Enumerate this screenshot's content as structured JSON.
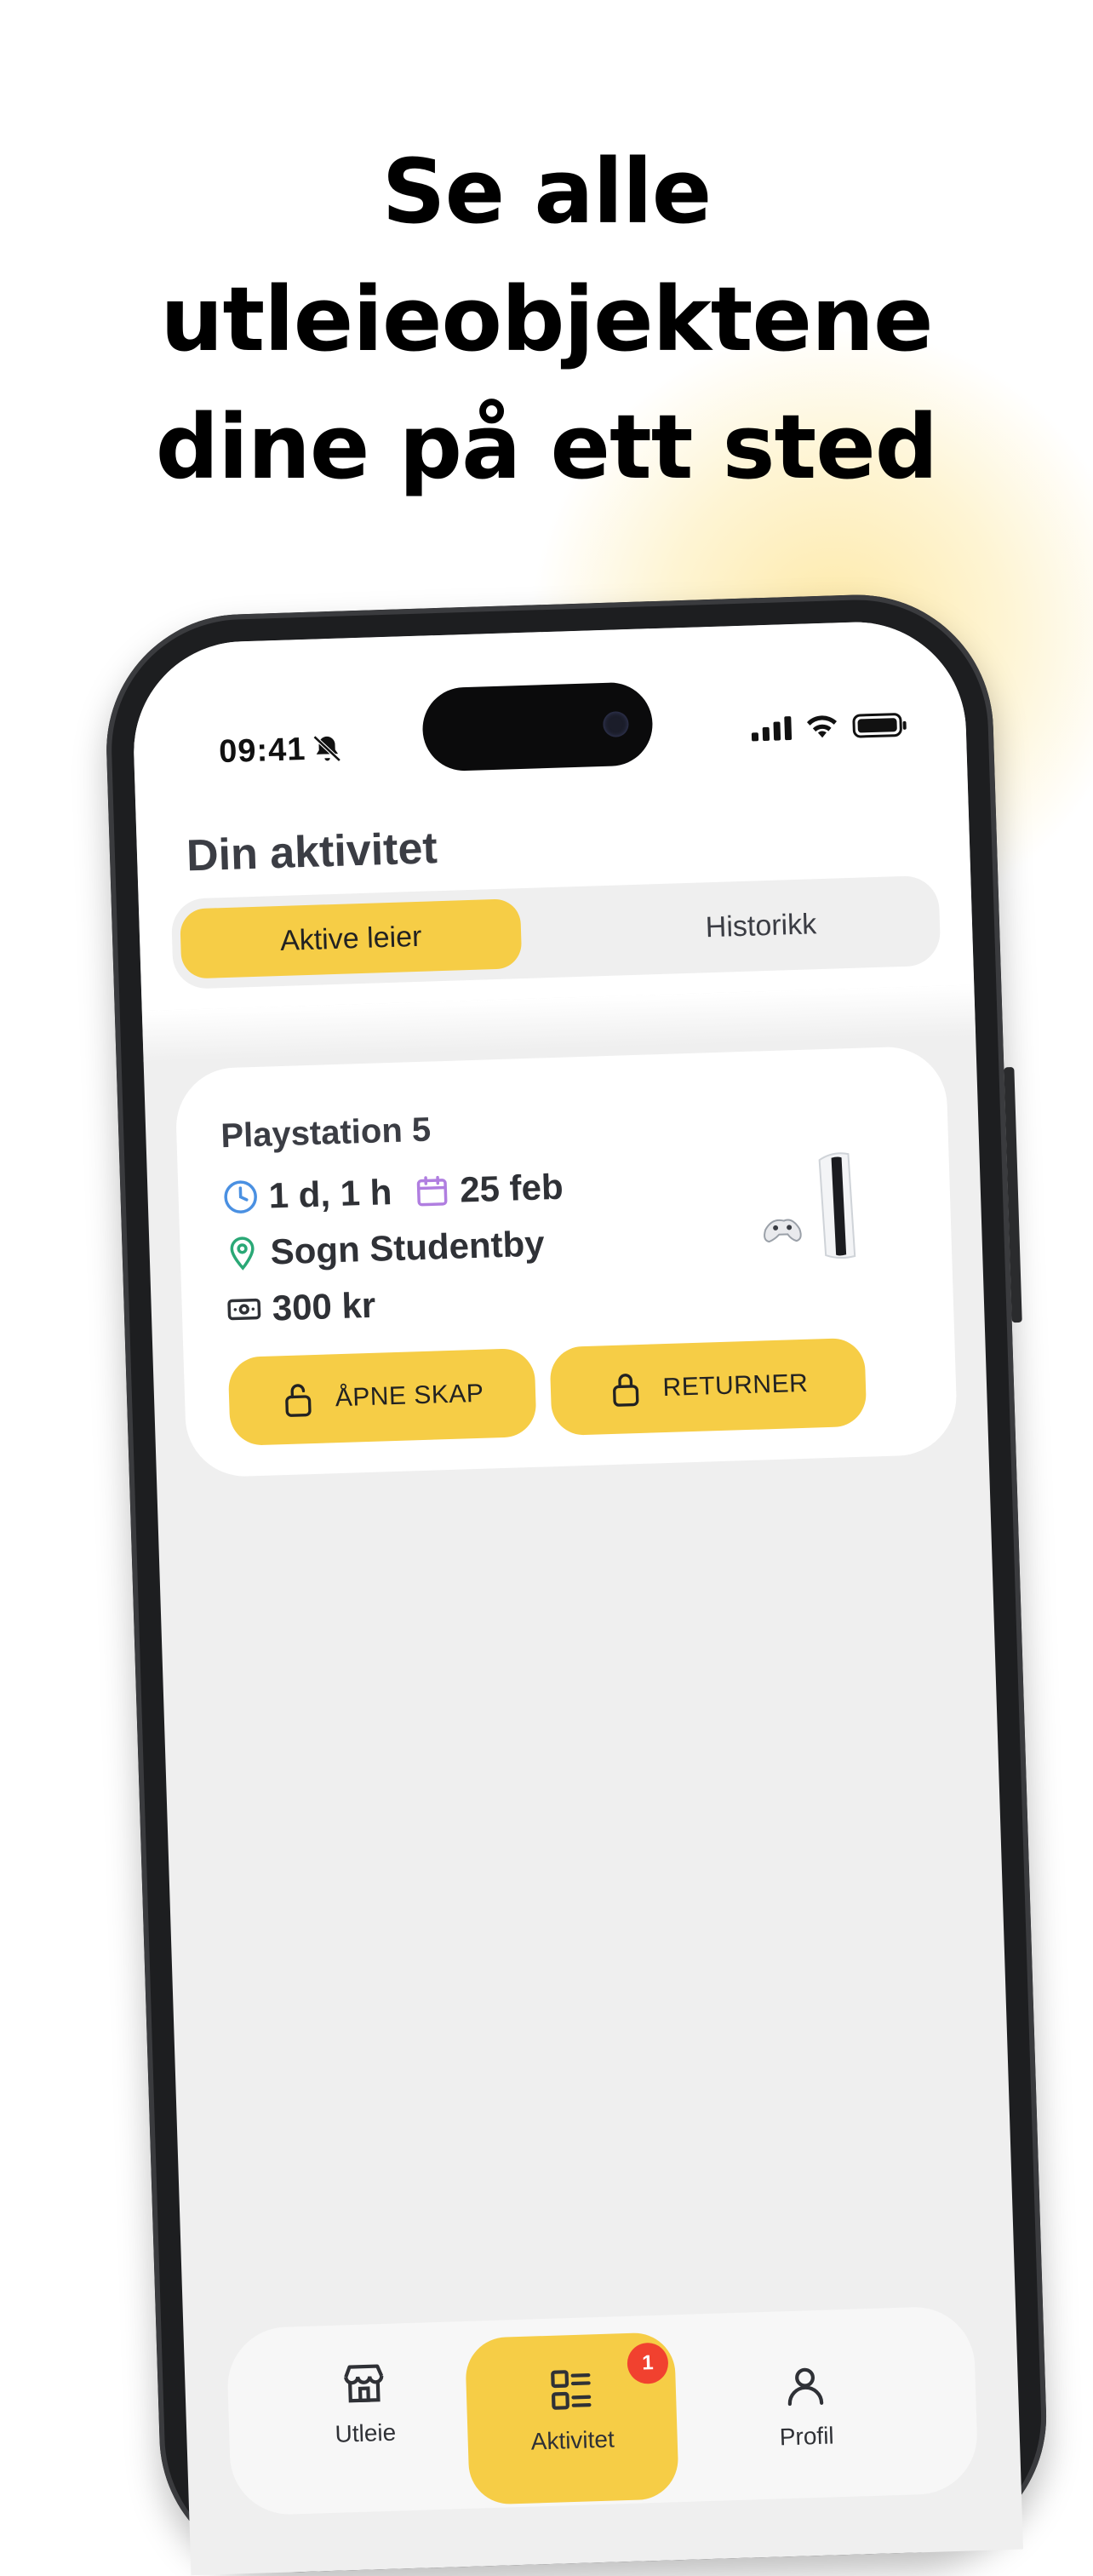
{
  "headline": {
    "line1": "Se alle",
    "line2": "utleieobjektene",
    "line3": "dine på ett sted"
  },
  "status_bar": {
    "time": "09:41",
    "icons": [
      "bell-slash-icon",
      "cellular-signal-icon",
      "wifi-icon",
      "battery-icon"
    ]
  },
  "page": {
    "title": "Din aktivitet"
  },
  "tabs": {
    "active_label": "Aktive leier",
    "inactive_label": "Historikk"
  },
  "rental": {
    "title": "Playstation 5",
    "duration": "1 d, 1 h",
    "date": "25 feb",
    "location": "Sogn Studentby",
    "price": "300 kr",
    "open_button": "ÅPNE SKAP",
    "return_button": "RETURNER",
    "product_image": "playstation-5-console-image"
  },
  "nav": {
    "utleie": "Utleie",
    "aktivitet": "Aktivitet",
    "profil": "Profil",
    "badge": "1",
    "active": "aktivitet"
  },
  "colors": {
    "accent": "#f6cd46",
    "badge": "#f1412f",
    "clock_icon": "#4a90e2",
    "calendar_icon": "#b07ee0",
    "location_icon": "#2aa876"
  }
}
